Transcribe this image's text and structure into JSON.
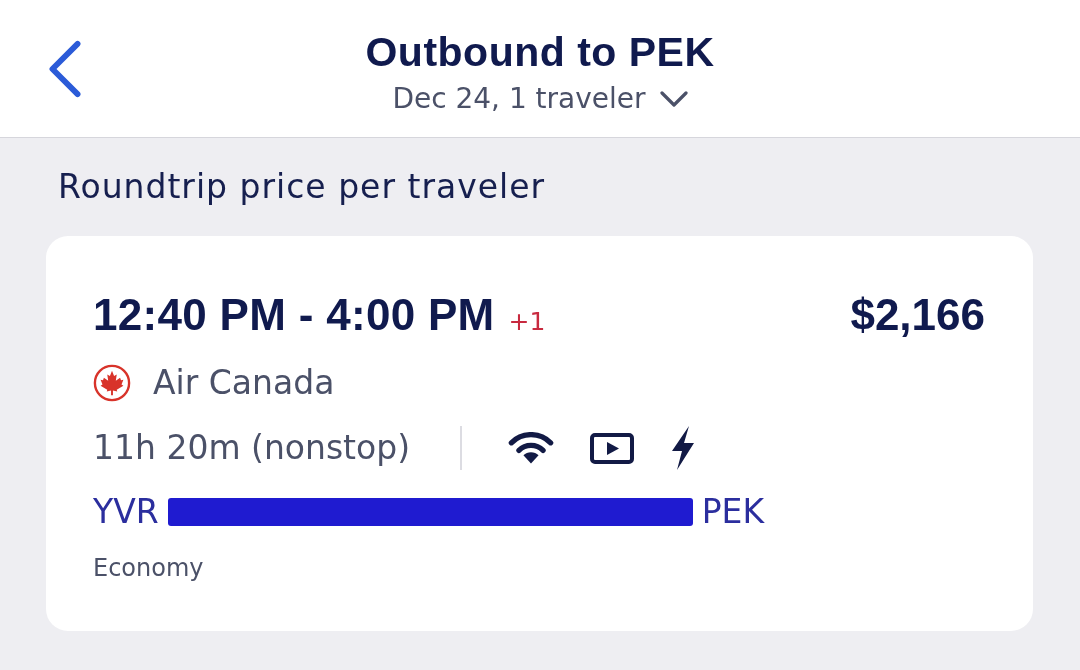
{
  "header": {
    "title": "Outbound to PEK",
    "subtitle": "Dec 24, 1 traveler"
  },
  "section_label": "Roundtrip price per traveler",
  "flight": {
    "times": "12:40 PM - 4:00 PM",
    "day_offset": "+1",
    "price": "$2,166",
    "airline": "Air Canada",
    "duration": "11h 20m (nonstop)",
    "amenities": [
      {
        "kind": "wifi"
      },
      {
        "kind": "video"
      },
      {
        "kind": "power"
      }
    ],
    "origin": "YVR",
    "destination": "PEK",
    "cabin": "Economy"
  }
}
